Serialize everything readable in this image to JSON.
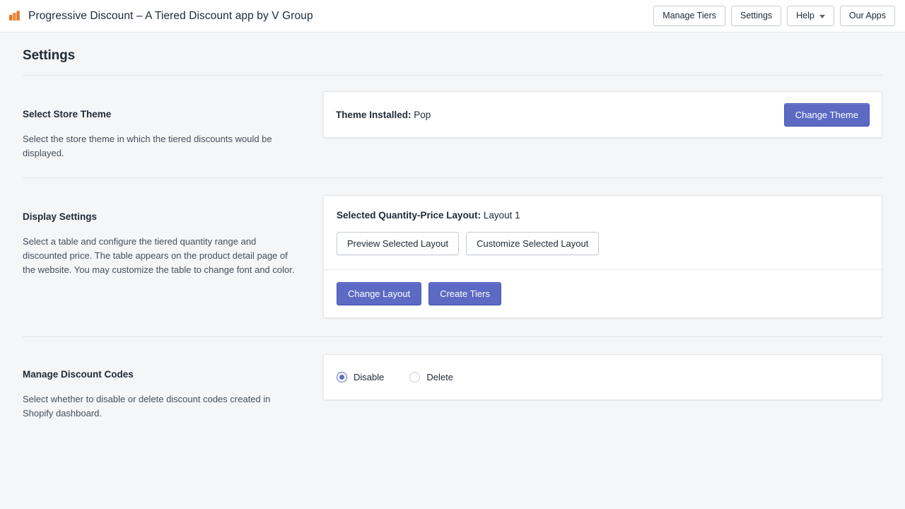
{
  "topbar": {
    "icon": "app-logo-icon",
    "app_title": "Progressive Discount – A Tiered Discount app by V Group",
    "buttons": [
      {
        "label": "Manage Tiers",
        "icon": null
      },
      {
        "label": "Settings",
        "icon": null
      },
      {
        "label": "Help",
        "icon": "chevron-down-icon"
      },
      {
        "label": "Our Apps",
        "icon": null
      }
    ]
  },
  "page": {
    "title": "Settings"
  },
  "sections": {
    "store_theme": {
      "title": "Select Store Theme",
      "description": "Select the store theme in which the tiered discounts would be displayed.",
      "theme_label": "Theme Installed:",
      "theme_value": "Pop",
      "change_theme_button": "Change Theme"
    },
    "display_settings": {
      "title": "Display Settings",
      "description": "Select a table and configure the tiered quantity range and discounted price. The table appears on the product detail page of the website. You may customize the table to change font and color.",
      "layout_label": "Selected Quantity-Price Layout:",
      "layout_value": "Layout 1",
      "preview_button": "Preview Selected Layout",
      "customize_button": "Customize Selected Layout",
      "change_layout_button": "Change Layout",
      "create_tiers_button": "Create Tiers"
    },
    "discount_codes": {
      "title": "Manage Discount Codes",
      "description": "Select whether to disable or delete discount codes created in Shopify dashboard.",
      "options": [
        {
          "label": "Disable",
          "selected": true
        },
        {
          "label": "Delete",
          "selected": false
        }
      ]
    }
  },
  "colors": {
    "primary": "#5c6ac4",
    "page_background": "#f4f6f8",
    "card_background": "#ffffff",
    "border": "#c4cdd5",
    "text": "#212b36",
    "app_icon": "#e8762c"
  }
}
